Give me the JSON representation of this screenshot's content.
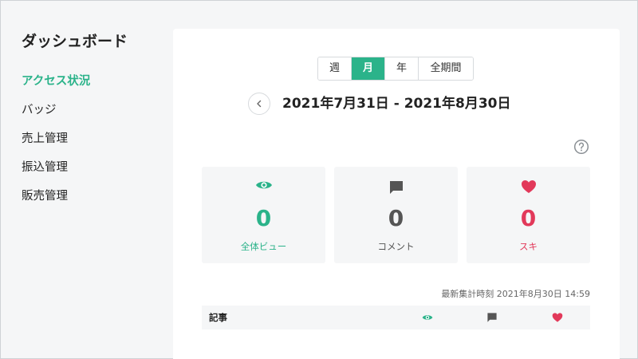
{
  "sidebar": {
    "title": "ダッシュボード",
    "items": [
      {
        "label": "アクセス状況",
        "active": true
      },
      {
        "label": "バッジ",
        "active": false
      },
      {
        "label": "売上管理",
        "active": false
      },
      {
        "label": "振込管理",
        "active": false
      },
      {
        "label": "販売管理",
        "active": false
      }
    ]
  },
  "period_tabs": [
    {
      "label": "週",
      "active": false
    },
    {
      "label": "月",
      "active": true
    },
    {
      "label": "年",
      "active": false
    },
    {
      "label": "全期間",
      "active": false
    }
  ],
  "date_range": "2021年7月31日 - 2021年8月30日",
  "stats": {
    "views": {
      "value": "0",
      "label": "全体ビュー",
      "icon": "eye-icon",
      "color": "#2bb38a"
    },
    "comments": {
      "value": "0",
      "label": "コメント",
      "icon": "comment-icon",
      "color": "#555555"
    },
    "likes": {
      "value": "0",
      "label": "スキ",
      "icon": "heart-icon",
      "color": "#e2395a"
    }
  },
  "last_updated": "最新集計時刻 2021年8月30日 14:59",
  "table": {
    "header_title": "記事",
    "columns": [
      "eye-icon",
      "comment-icon",
      "heart-icon"
    ]
  },
  "colors": {
    "accent": "#2bb38a",
    "like": "#e2395a",
    "background": "#f5f6f7"
  }
}
